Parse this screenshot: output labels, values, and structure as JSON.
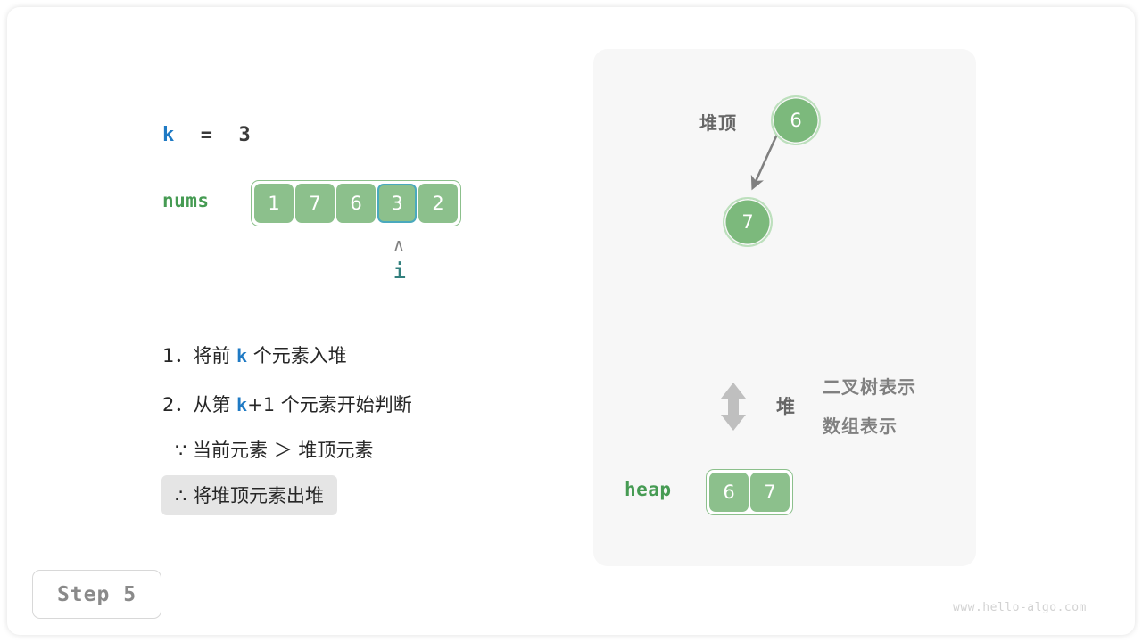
{
  "diagram": {
    "step_badge": "Step 5",
    "watermark": "www.hello-algo.com",
    "colors": {
      "node_fill": "#7cb97c",
      "node_ring": "#bde0bd",
      "cell_fill": "#8cc08c",
      "cell_border": "#8cc08c",
      "highlight_border": "#4aa9bd",
      "var_blue": "#1f7ac4",
      "var_green": "#469b53",
      "pointer_teal": "#33807e",
      "panel_bg": "#f7f7f7",
      "highlight_row_bg": "#e5e5e5",
      "arrow_gray": "#808080",
      "swap_icon_gray": "#bfbfbf"
    }
  },
  "left": {
    "k_var": "k",
    "k_equals": "  =  ",
    "k_value": "3",
    "nums_label": "nums",
    "nums_values": [
      "1",
      "7",
      "6",
      "3",
      "2"
    ],
    "nums_highlight_index": 3,
    "pointer_caret": "∧",
    "pointer_label": "i",
    "steps": [
      {
        "num": "1．将前 ",
        "var": "k",
        "rest": " 个元素入堆"
      },
      {
        "num": "2．从第 ",
        "var": "k",
        "rest": "+1 个元素开始判断"
      }
    ],
    "condition_line": "∵ 当前元素 ＞ 堆顶元素",
    "conclusion_line": "∴ 将堆顶元素出堆"
  },
  "right": {
    "heap_top_label": "堆顶",
    "tree_nodes": [
      {
        "name": "root",
        "value": "6"
      },
      {
        "name": "child",
        "value": "7"
      }
    ],
    "legend": {
      "heap_word": "堆",
      "tree_repr": "二叉树表示",
      "array_repr": "数组表示"
    },
    "heap_label": "heap",
    "heap_values": [
      "6",
      "7"
    ]
  }
}
